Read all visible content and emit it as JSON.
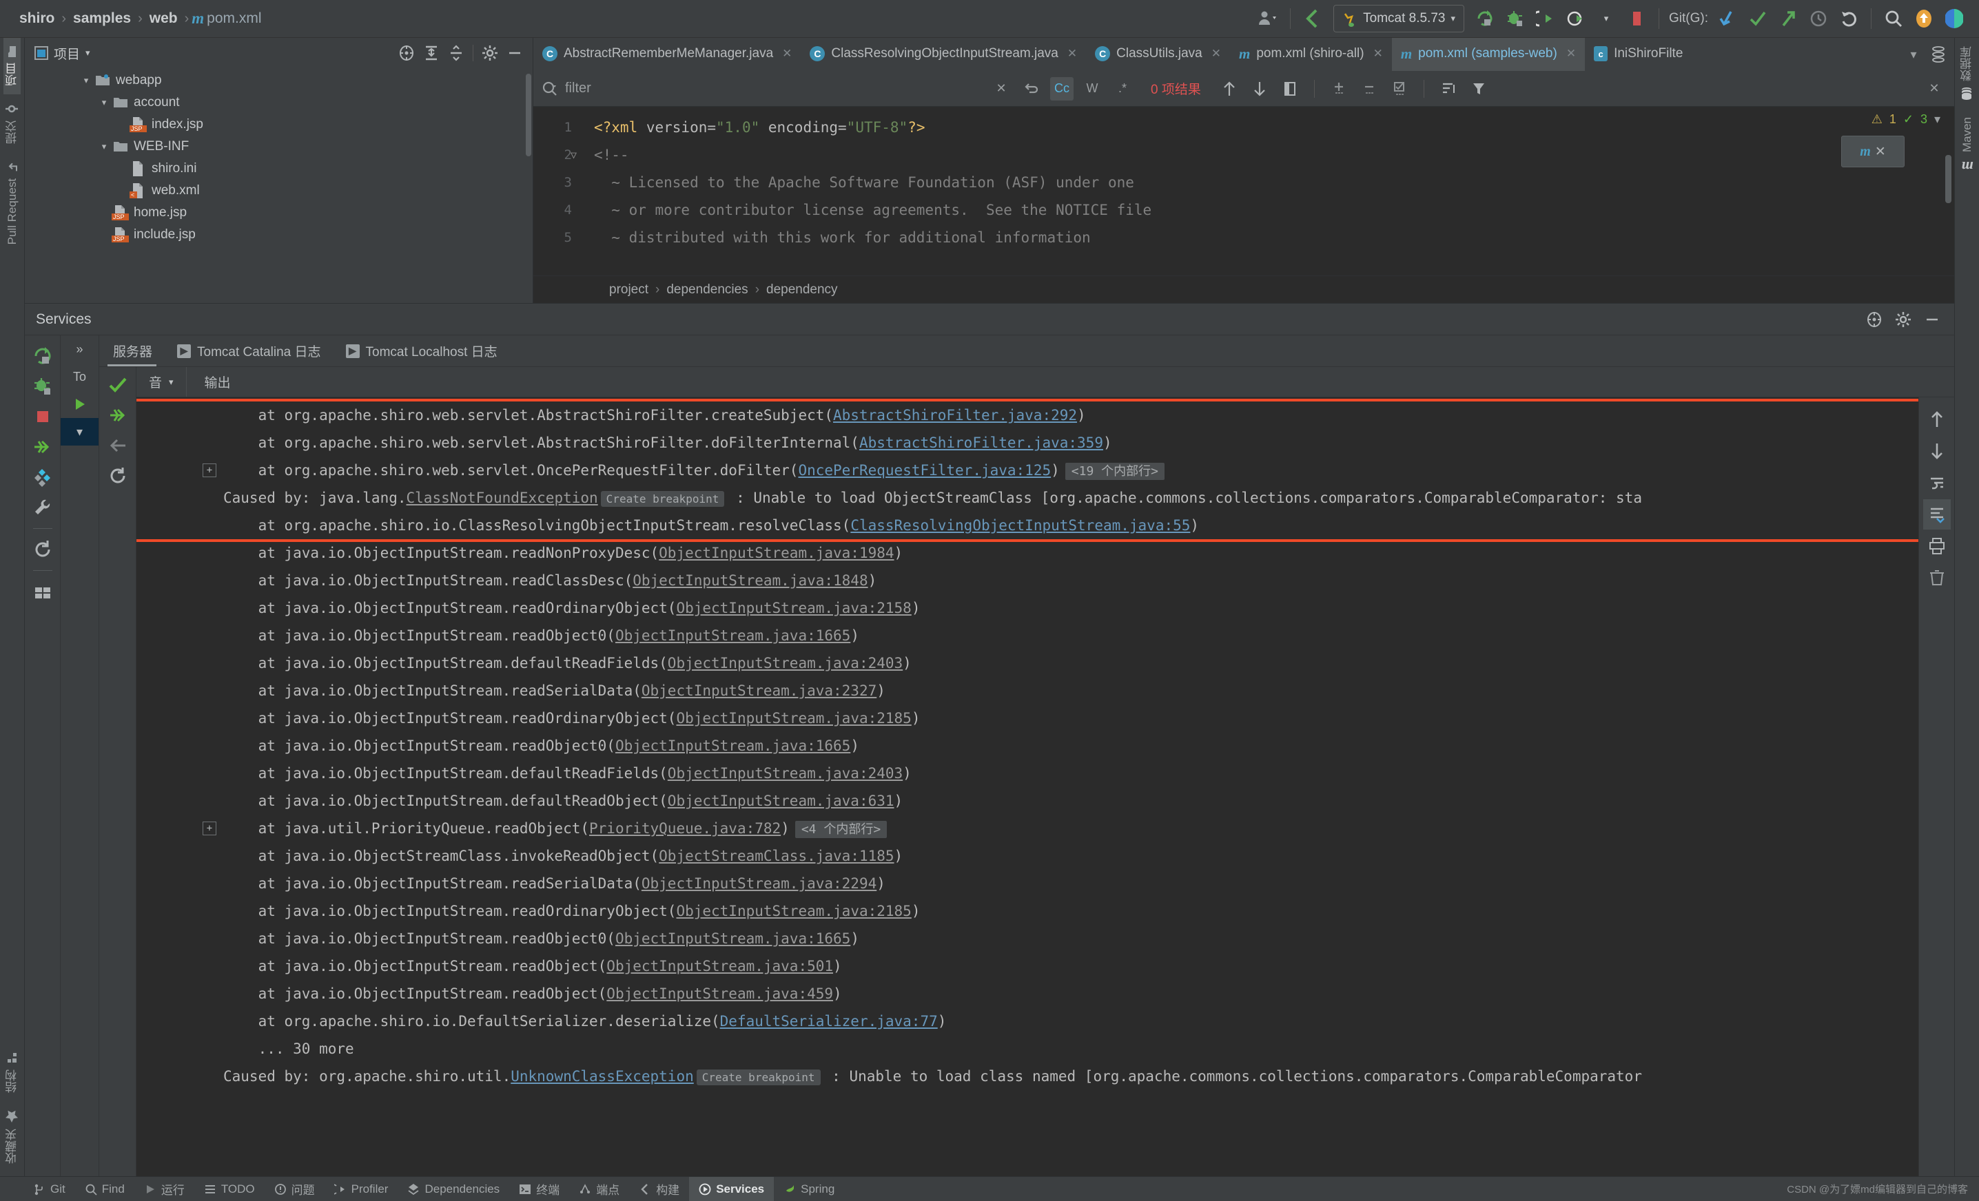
{
  "breadcrumb": {
    "items": [
      "shiro",
      "samples",
      "web"
    ],
    "file": "pom.xml",
    "file_icon": "maven-m-icon"
  },
  "toolbar": {
    "user_icon": "user-dropdown-icon",
    "back_icon": "back-arrow-icon",
    "run_config": "Tomcat 8.5.73",
    "run_config_icon": "tomcat-cat-icon",
    "rerun_icon": "rerun-icon",
    "debug_icon": "debug-bug-icon",
    "run_icon": "run-icon",
    "profile_icon": "profile-icon",
    "stop_icon": "stop-icon",
    "git_label": "Git(G):",
    "git_update_icon": "git-update-icon",
    "git_commit_icon": "git-commit-check-icon",
    "git_push_icon": "git-push-icon",
    "git_history_icon": "git-history-icon",
    "git_rollback_icon": "git-rollback-icon",
    "search_icon": "search-everywhere-icon",
    "update_icon": "update-badge-icon",
    "plugin_icon": "plugin-icon"
  },
  "left_strip": {
    "items": [
      {
        "label": "项目",
        "icon": "project-folder-icon",
        "active": true
      },
      {
        "label": "提交",
        "icon": "commit-icon",
        "active": false
      },
      {
        "label": "Pull Request",
        "icon": "pull-request-icon",
        "active": false
      }
    ],
    "bottom_items": [
      {
        "label": "结构",
        "icon": "structure-icon"
      },
      {
        "label": "收藏夹",
        "icon": "favorites-star-icon"
      }
    ]
  },
  "right_strip": {
    "items": [
      {
        "label": "数据库",
        "icon": "database-icon"
      },
      {
        "label": "Maven",
        "icon": "maven-m-icon"
      }
    ]
  },
  "project_panel": {
    "title": "项目",
    "dropdown_icon": "chevron-down-icon",
    "actions": [
      "locate-icon",
      "expand-all-icon",
      "collapse-all-icon",
      "gear-icon",
      "minimize-icon"
    ],
    "tree": [
      {
        "name": "webapp",
        "indent": 3,
        "twist": "v",
        "icon": "folder-web-icon"
      },
      {
        "name": "account",
        "indent": 4,
        "twist": "v",
        "icon": "folder-icon"
      },
      {
        "name": "index.jsp",
        "indent": 5,
        "twist": "",
        "icon": "jsp-file-icon"
      },
      {
        "name": "WEB-INF",
        "indent": 4,
        "twist": "v",
        "icon": "folder-icon"
      },
      {
        "name": "shiro.ini",
        "indent": 5,
        "twist": "",
        "icon": "ini-file-icon"
      },
      {
        "name": "web.xml",
        "indent": 5,
        "twist": "",
        "icon": "xml-file-icon"
      },
      {
        "name": "home.jsp",
        "indent": 4,
        "twist": "",
        "icon": "jsp-file-icon"
      },
      {
        "name": "include.jsp",
        "indent": 4,
        "twist": "",
        "icon": "jsp-file-icon"
      }
    ]
  },
  "editor": {
    "tabs": [
      {
        "label": "AbstractRememberMeManager.java",
        "icon": "java-class-icon",
        "active": false,
        "closable": true
      },
      {
        "label": "ClassResolvingObjectInputStream.java",
        "icon": "java-class-icon",
        "active": false,
        "closable": true
      },
      {
        "label": "ClassUtils.java",
        "icon": "java-class-icon",
        "active": false,
        "closable": true
      },
      {
        "label": "pom.xml (shiro-all)",
        "icon": "maven-m-icon",
        "active": false,
        "closable": true
      },
      {
        "label": "pom.xml (samples-web)",
        "icon": "maven-m-icon",
        "active": true,
        "closable": true
      },
      {
        "label": "IniShiroFilte",
        "icon": "ini-file-icon",
        "active": false,
        "closable": false
      }
    ],
    "tabs_overflow_icon": "chevron-down-icon",
    "tabs_list_icon": "tab-list-icon",
    "find": {
      "placeholder": "filter",
      "search_icon": "search-icon",
      "clear_icon": "close-icon",
      "history_icon": "history-icon",
      "match_case": "Cc",
      "words": "W",
      "regex": ".*",
      "results": "0 项结果",
      "prev_icon": "arrow-up-icon",
      "next_icon": "arrow-down-icon",
      "select_all_icon": "select-all-icon",
      "add_icon": "add-icon",
      "remove_icon": "remove-icon",
      "check_icon": "check-icon",
      "sort_icon": "sort-icon",
      "filter_icon": "filter-icon",
      "close_icon": "close-icon"
    },
    "lines": [
      {
        "num": "1",
        "fold": false,
        "parts": [
          {
            "t": "<?xml ",
            "c": "c-tag"
          },
          {
            "t": "version=",
            "c": "c-attr"
          },
          {
            "t": "\"1.0\"",
            "c": "c-str"
          },
          {
            "t": " encoding=",
            "c": "c-attr"
          },
          {
            "t": "\"UTF-8\"",
            "c": "c-str"
          },
          {
            "t": "?>",
            "c": "c-tag"
          }
        ]
      },
      {
        "num": "2",
        "fold": true,
        "parts": [
          {
            "t": "<!--",
            "c": "c-com"
          }
        ]
      },
      {
        "num": "3",
        "fold": false,
        "parts": [
          {
            "t": "  ~ Licensed to the Apache Software Foundation (ASF) under one",
            "c": "c-com"
          }
        ]
      },
      {
        "num": "4",
        "fold": false,
        "parts": [
          {
            "t": "  ~ or more contributor license agreements.  See the NOTICE file",
            "c": "c-com"
          }
        ]
      },
      {
        "num": "5",
        "fold": false,
        "parts": [
          {
            "t": "  ~ distributed with this work for additional information",
            "c": "c-com"
          }
        ]
      }
    ],
    "warnings": {
      "warn_count": "1",
      "ok_count": "3",
      "warn_icon": "warning-icon",
      "ok_icon": "checkmark-icon",
      "chevron": "chevron-down-icon"
    },
    "popup": {
      "icon": "maven-reload-icon",
      "close_icon": "close-icon"
    },
    "breadcrumb": [
      "project",
      "dependencies",
      "dependency"
    ]
  },
  "services": {
    "title": "Services",
    "head_actions": [
      "locate-icon",
      "gear-icon",
      "minimize-icon"
    ],
    "tools": [
      "rerun-icon",
      "debug-icon",
      "stop-icon",
      "jump-to-source-icon",
      "layout-icon",
      "wrench-icon",
      "refresh-icon",
      "grid-icon"
    ],
    "tree_expand_icon": "chevron-right-icon",
    "tree_rows": [
      {
        "label": "To",
        "icon": "tomcat-icon"
      },
      {
        "label": "",
        "icon": "run-green-icon"
      },
      {
        "label": "",
        "icon": "chevron-down-icon",
        "selected": true
      }
    ],
    "tabs": [
      {
        "label": "服务器",
        "icon": "",
        "active": true
      },
      {
        "label": "Tomcat Catalina 日志",
        "icon": "run-box-icon",
        "active": false
      },
      {
        "label": "Tomcat Localhost 日志",
        "icon": "run-box-icon",
        "active": false
      }
    ],
    "sub_tools": [
      "check-icon",
      "jump-to-source-icon",
      "soft-wrap-icon",
      "restart-icon"
    ],
    "output_dropdown": "音",
    "output_dropdown_icon": "chevron-down-icon",
    "output_label": "输出",
    "right_tools": [
      "scroll-up-icon",
      "scroll-down-icon",
      "soft-wrap-icon",
      "scroll-to-end-icon",
      "print-icon",
      "trash-icon"
    ]
  },
  "console": {
    "highlight_box": {
      "color": "#f04a28"
    },
    "lines": [
      {
        "indent": "    at ",
        "text": "org.apache.shiro.web.servlet.AbstractShiroFilter.createSubject(",
        "link": "AbstractShiroFilter.java:292",
        "link_style": "blue",
        "tail": ")",
        "highlighted": true,
        "plus": false
      },
      {
        "indent": "    at ",
        "text": "org.apache.shiro.web.servlet.AbstractShiroFilter.doFilterInternal(",
        "link": "AbstractShiroFilter.java:359",
        "link_style": "blue",
        "tail": ")",
        "highlighted": true,
        "plus": false
      },
      {
        "indent": "    at ",
        "text": "org.apache.shiro.web.servlet.OncePerRequestFilter.doFilter(",
        "link": "OncePerRequestFilter.java:125",
        "link_style": "blue",
        "tail": ")",
        "frames": "<19 个内部行>",
        "highlighted": true,
        "plus": true
      },
      {
        "indent": "",
        "text": "Caused by: java.lang.",
        "exception": "ClassNotFoundException",
        "exc_style": "grey",
        "breakpoint": "Create breakpoint",
        "after": " : Unable to load ObjectStreamClass [org.apache.commons.collections.comparators.ComparableComparator: sta",
        "highlighted": true,
        "plus": false
      },
      {
        "indent": "    at ",
        "text": "org.apache.shiro.io.ClassResolvingObjectInputStream.resolveClass(",
        "link": "ClassResolvingObjectInputStream.java:55",
        "link_style": "blue",
        "tail": ")",
        "highlighted": true,
        "plus": false
      },
      {
        "indent": "    at ",
        "text": "java.io.ObjectInputStream.readNonProxyDesc(",
        "link": "ObjectInputStream.java:1984",
        "link_style": "grey",
        "tail": ")",
        "highlighted": false,
        "plus": false
      },
      {
        "indent": "    at ",
        "text": "java.io.ObjectInputStream.readClassDesc(",
        "link": "ObjectInputStream.java:1848",
        "link_style": "grey",
        "tail": ")",
        "highlighted": false,
        "plus": false
      },
      {
        "indent": "    at ",
        "text": "java.io.ObjectInputStream.readOrdinaryObject(",
        "link": "ObjectInputStream.java:2158",
        "link_style": "grey",
        "tail": ")",
        "highlighted": false,
        "plus": false
      },
      {
        "indent": "    at ",
        "text": "java.io.ObjectInputStream.readObject0(",
        "link": "ObjectInputStream.java:1665",
        "link_style": "grey",
        "tail": ")",
        "highlighted": false,
        "plus": false
      },
      {
        "indent": "    at ",
        "text": "java.io.ObjectInputStream.defaultReadFields(",
        "link": "ObjectInputStream.java:2403",
        "link_style": "grey",
        "tail": ")",
        "highlighted": false,
        "plus": false
      },
      {
        "indent": "    at ",
        "text": "java.io.ObjectInputStream.readSerialData(",
        "link": "ObjectInputStream.java:2327",
        "link_style": "grey",
        "tail": ")",
        "highlighted": false,
        "plus": false
      },
      {
        "indent": "    at ",
        "text": "java.io.ObjectInputStream.readOrdinaryObject(",
        "link": "ObjectInputStream.java:2185",
        "link_style": "grey",
        "tail": ")",
        "highlighted": false,
        "plus": false
      },
      {
        "indent": "    at ",
        "text": "java.io.ObjectInputStream.readObject0(",
        "link": "ObjectInputStream.java:1665",
        "link_style": "grey",
        "tail": ")",
        "highlighted": false,
        "plus": false
      },
      {
        "indent": "    at ",
        "text": "java.io.ObjectInputStream.defaultReadFields(",
        "link": "ObjectInputStream.java:2403",
        "link_style": "grey",
        "tail": ")",
        "highlighted": false,
        "plus": false
      },
      {
        "indent": "    at ",
        "text": "java.io.ObjectInputStream.defaultReadObject(",
        "link": "ObjectInputStream.java:631",
        "link_style": "grey",
        "tail": ")",
        "highlighted": false,
        "plus": false
      },
      {
        "indent": "    at ",
        "text": "java.util.PriorityQueue.readObject(",
        "link": "PriorityQueue.java:782",
        "link_style": "grey",
        "tail": ")",
        "frames": "<4 个内部行>",
        "highlighted": false,
        "plus": true
      },
      {
        "indent": "    at ",
        "text": "java.io.ObjectStreamClass.invokeReadObject(",
        "link": "ObjectStreamClass.java:1185",
        "link_style": "grey",
        "tail": ")",
        "highlighted": false,
        "plus": false
      },
      {
        "indent": "    at ",
        "text": "java.io.ObjectInputStream.readSerialData(",
        "link": "ObjectInputStream.java:2294",
        "link_style": "grey",
        "tail": ")",
        "highlighted": false,
        "plus": false
      },
      {
        "indent": "    at ",
        "text": "java.io.ObjectInputStream.readOrdinaryObject(",
        "link": "ObjectInputStream.java:2185",
        "link_style": "grey",
        "tail": ")",
        "highlighted": false,
        "plus": false
      },
      {
        "indent": "    at ",
        "text": "java.io.ObjectInputStream.readObject0(",
        "link": "ObjectInputStream.java:1665",
        "link_style": "grey",
        "tail": ")",
        "highlighted": false,
        "plus": false
      },
      {
        "indent": "    at ",
        "text": "java.io.ObjectInputStream.readObject(",
        "link": "ObjectInputStream.java:501",
        "link_style": "grey",
        "tail": ")",
        "highlighted": false,
        "plus": false
      },
      {
        "indent": "    at ",
        "text": "java.io.ObjectInputStream.readObject(",
        "link": "ObjectInputStream.java:459",
        "link_style": "grey",
        "tail": ")",
        "highlighted": false,
        "plus": false
      },
      {
        "indent": "    at ",
        "text": "org.apache.shiro.io.DefaultSerializer.deserialize(",
        "link": "DefaultSerializer.java:77",
        "link_style": "blue",
        "tail": ")",
        "highlighted": false,
        "plus": false
      },
      {
        "indent": "    ... 30 more",
        "text": "",
        "highlighted": false,
        "plus": false
      },
      {
        "indent": "",
        "text": "Caused by: org.apache.shiro.util.",
        "exception": "UnknownClassException",
        "exc_style": "blue",
        "breakpoint": "Create breakpoint",
        "after": " : Unable to load class named [org.apache.commons.collections.comparators.ComparableComparator",
        "highlighted": false,
        "plus": false
      }
    ]
  },
  "statusbar": {
    "items": [
      {
        "label": "Git",
        "icon": "git-branch-icon",
        "active": false
      },
      {
        "label": "Find",
        "icon": "search-icon",
        "active": false
      },
      {
        "label": "运行",
        "icon": "run-icon",
        "active": false
      },
      {
        "label": "TODO",
        "icon": "todo-icon",
        "active": false
      },
      {
        "label": "问题",
        "icon": "problems-icon",
        "active": false
      },
      {
        "label": "Profiler",
        "icon": "profiler-icon",
        "active": false
      },
      {
        "label": "Dependencies",
        "icon": "dependencies-icon",
        "active": false
      },
      {
        "label": "终端",
        "icon": "terminal-icon",
        "active": false
      },
      {
        "label": "端点",
        "icon": "endpoints-icon",
        "active": false
      },
      {
        "label": "构建",
        "icon": "build-icon",
        "active": false
      },
      {
        "label": "Services",
        "icon": "services-icon",
        "active": true
      },
      {
        "label": "Spring",
        "icon": "spring-icon",
        "active": false
      }
    ],
    "watermark": "CSDN @为了嫖md编辑器到自己的博客"
  }
}
